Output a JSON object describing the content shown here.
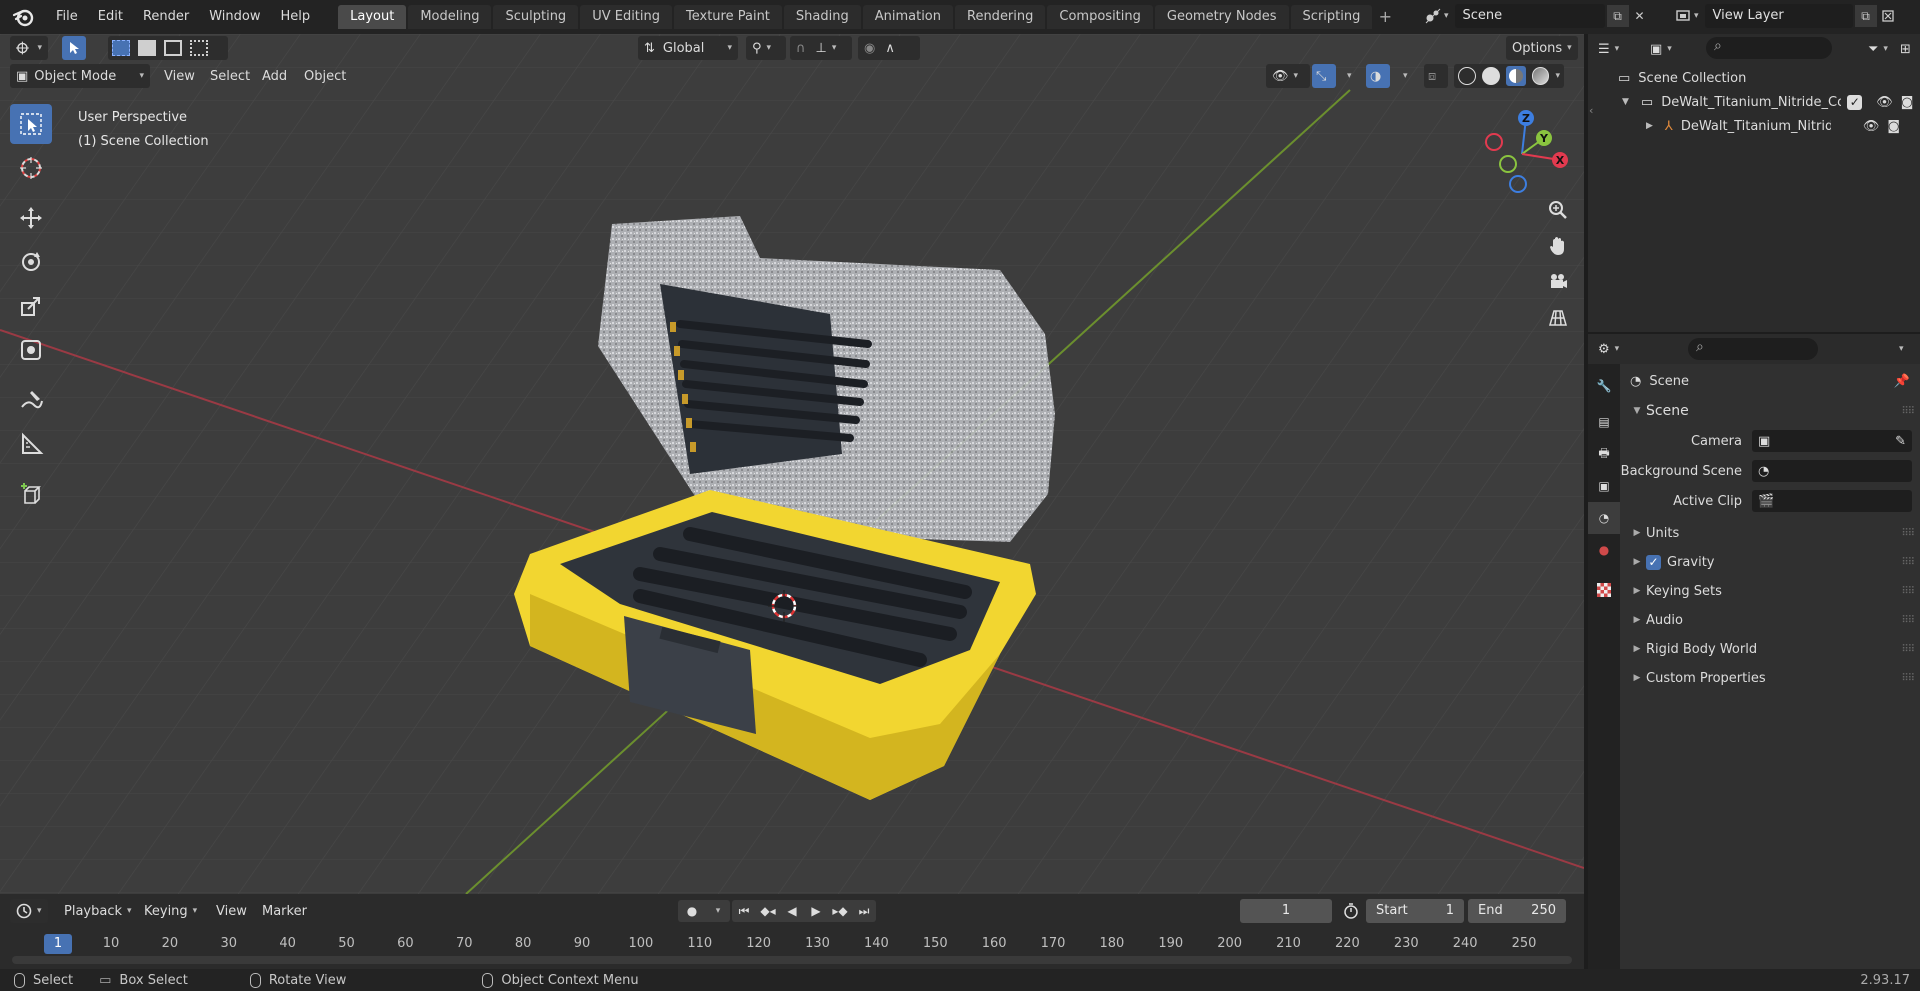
{
  "menu": {
    "items": [
      "File",
      "Edit",
      "Render",
      "Window",
      "Help"
    ]
  },
  "workspaces": {
    "tabs": [
      "Layout",
      "Modeling",
      "Sculpting",
      "UV Editing",
      "Texture Paint",
      "Shading",
      "Animation",
      "Rendering",
      "Compositing",
      "Geometry Nodes",
      "Scripting"
    ],
    "active": "Layout"
  },
  "scene_selector": {
    "value": "Scene"
  },
  "view_layer_selector": {
    "value": "View Layer"
  },
  "viewport": {
    "transform_orientation": "Global",
    "options_label": "Options",
    "mode": "Object Mode",
    "menus": [
      "View",
      "Select",
      "Add",
      "Object"
    ],
    "info_line1": "User Perspective",
    "info_line2": "(1) Scene Collection",
    "gizmo_axes": [
      "Z",
      "Y",
      "X"
    ]
  },
  "timeline": {
    "menus": [
      "Playback",
      "Keying",
      "View",
      "Marker"
    ],
    "current_frame": "1",
    "start_label": "Start",
    "start_value": "1",
    "end_label": "End",
    "end_value": "250",
    "ruler": [
      "1",
      "10",
      "20",
      "30",
      "40",
      "50",
      "60",
      "70",
      "80",
      "90",
      "100",
      "110",
      "120",
      "130",
      "140",
      "150",
      "160",
      "170",
      "180",
      "190",
      "200",
      "210",
      "220",
      "230",
      "240",
      "250"
    ]
  },
  "statusbar": {
    "select": "Select",
    "box_select": "Box Select",
    "rotate_view": "Rotate View",
    "context_menu": "Object Context Menu",
    "version": "2.93.17"
  },
  "outliner": {
    "root": "Scene Collection",
    "collection": "DeWalt_Titanium_Nitride_Coa",
    "object": "DeWalt_Titanium_Nitride"
  },
  "properties": {
    "context": "Scene",
    "panel": "Scene",
    "camera_label": "Camera",
    "background_scene_label": "Background Scene",
    "active_clip_label": "Active Clip",
    "sections": [
      "Units",
      "Gravity",
      "Keying Sets",
      "Audio",
      "Rigid Body World",
      "Custom Properties"
    ]
  },
  "colors": {
    "accent": "#4772b3",
    "axis_x": "#e23a4f",
    "axis_y": "#8ac43f",
    "axis_z": "#3d7ee0",
    "case_yellow": "#f2d630"
  }
}
